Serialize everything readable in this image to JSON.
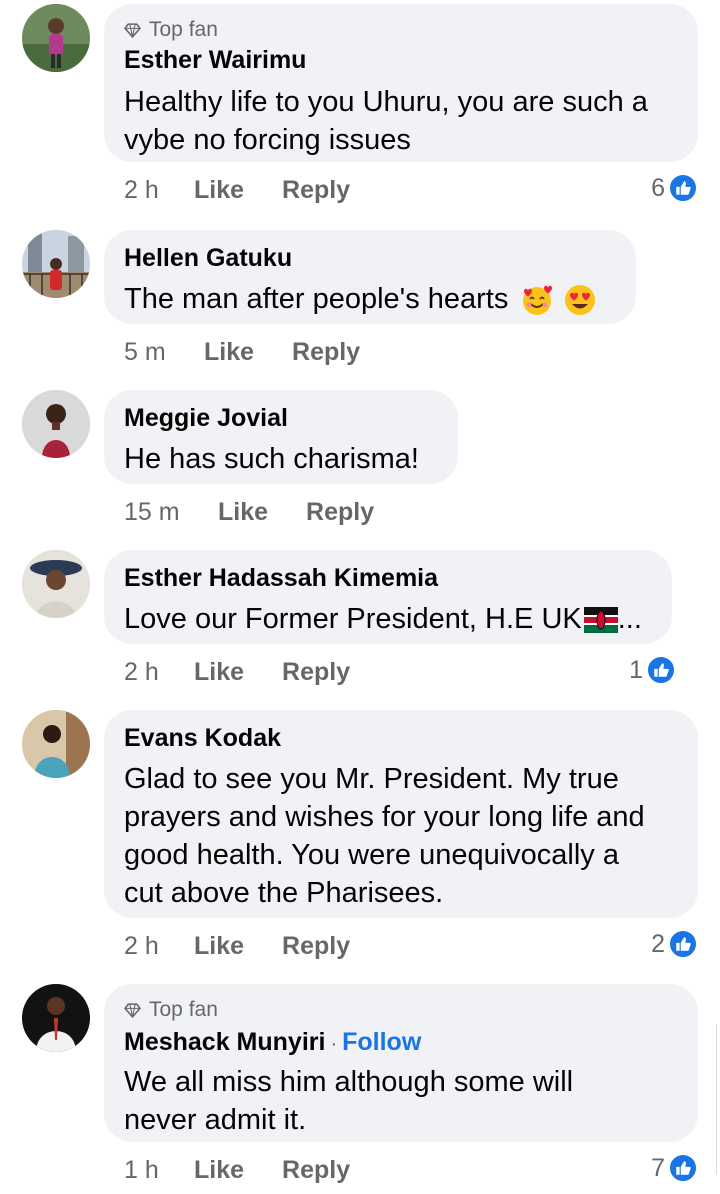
{
  "comments": [
    {
      "badge": "Top fan",
      "author": "Esther Wairimu",
      "lines": [
        "Healthy life to you Uhuru, you are such a",
        "vybe no forcing issues"
      ],
      "time": "2 h",
      "like": "Like",
      "reply": "Reply",
      "reactions": "6"
    },
    {
      "author": "Hellen Gatuku",
      "lines": [
        "The man after people's hearts"
      ],
      "emojis": [
        "smiling-face-with-hearts-emoji",
        "heart-eyes-emoji"
      ],
      "time": "5 m",
      "like": "Like",
      "reply": "Reply"
    },
    {
      "author": "Meggie Jovial",
      "lines": [
        "He has such charisma!"
      ],
      "time": "15 m",
      "like": "Like",
      "reply": "Reply"
    },
    {
      "author": "Esther Hadassah Kimemia",
      "lines": [
        "Love our Former President, H.E UK"
      ],
      "trailing": "...",
      "flag": "kenya-flag-emoji",
      "time": "2 h",
      "like": "Like",
      "reply": "Reply",
      "reactions": "1"
    },
    {
      "author": "Evans Kodak",
      "lines": [
        "Glad to see you Mr. President. My true",
        "prayers and wishes for your long life and",
        "good health. You were unequivocally a",
        "cut above the Pharisees."
      ],
      "time": "2 h",
      "like": "Like",
      "reply": "Reply",
      "reactions": "2"
    },
    {
      "badge": "Top fan",
      "author": "Meshack Munyiri",
      "separator": "·",
      "follow": "Follow",
      "lines": [
        "We all miss him although some will",
        "never admit it."
      ],
      "time": "1 h",
      "like": "Like",
      "reply": "Reply",
      "reactions": "7"
    }
  ],
  "colors": {
    "bubble": "#f0f2f5",
    "meta": "#65676b",
    "link": "#1b74e4",
    "like_reaction": "#1b74e4"
  }
}
